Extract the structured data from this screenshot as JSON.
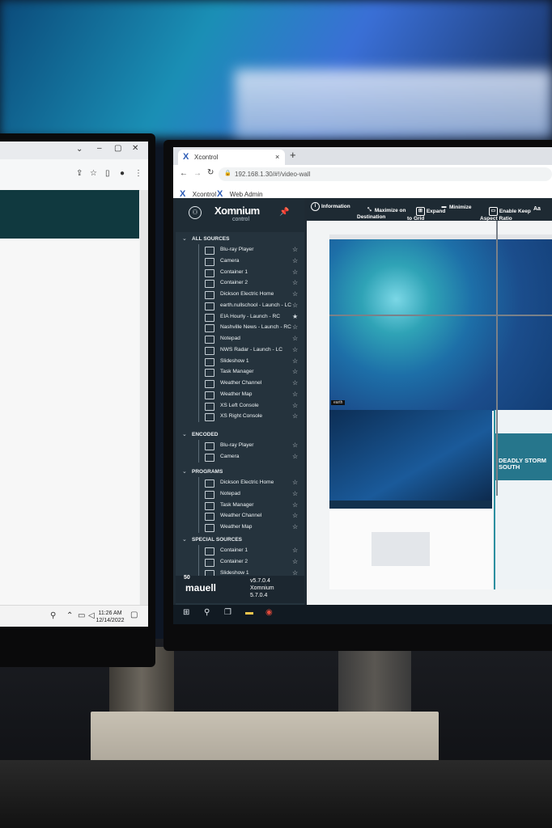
{
  "left_screen": {
    "clock_time": "11:26 AM",
    "clock_date": "12/14/2022"
  },
  "browser": {
    "tab_title": "Xcontrol",
    "new_tab": "+",
    "tab_close": "×",
    "url": "192.168.1.30/#!/video-wall",
    "bookmarks": [
      {
        "label": "Xcontrol"
      },
      {
        "label": "Web Admin"
      }
    ]
  },
  "app": {
    "brand_name": "Xomnium",
    "brand_sub": "control",
    "toolbar": {
      "information": "Information",
      "maximize": "Maximize on\nDestination",
      "expand": "Expand\nto Grid",
      "minimize": "Minimize",
      "keep_aspect": "Enable Keep\nAspect Ratio"
    },
    "sections": {
      "all_sources": "ALL SOURCES",
      "encoded": "ENCODED",
      "programs": "PROGRAMS",
      "special": "SPECIAL SOURCES"
    },
    "all_sources_items": [
      {
        "label": "Blu-ray Player",
        "star": "☆",
        "icon": "projector-icon"
      },
      {
        "label": "Camera",
        "star": "☆",
        "icon": "camera-icon"
      },
      {
        "label": "Container 1",
        "star": "☆",
        "icon": "grid-icon"
      },
      {
        "label": "Container 2",
        "star": "☆",
        "icon": "grid-icon"
      },
      {
        "label": "Dickson Electric Home",
        "star": "☆",
        "icon": "window-icon"
      },
      {
        "label": "earth.nullschool - Launch - LC",
        "star": "☆",
        "icon": "cast-icon"
      },
      {
        "label": "EIA Hourly - Launch - RC",
        "star": "★",
        "icon": "cast-icon"
      },
      {
        "label": "Nashville News - Launch - RC",
        "star": "☆",
        "icon": "cast-icon"
      },
      {
        "label": "Notepad",
        "star": "☆",
        "icon": "window-icon"
      },
      {
        "label": "NWS Radar - Launch - LC",
        "star": "☆",
        "icon": "cast-icon"
      },
      {
        "label": "Slideshow 1",
        "star": "☆",
        "icon": "slideshow-icon"
      },
      {
        "label": "Task Manager",
        "star": "☆",
        "icon": "window-icon"
      },
      {
        "label": "Weather Channel",
        "star": "☆",
        "icon": "window-icon"
      },
      {
        "label": "Weather Map",
        "star": "☆",
        "icon": "window-icon"
      },
      {
        "label": "XS Left Console",
        "star": "☆",
        "icon": "monitor-icon"
      },
      {
        "label": "XS Right Console",
        "star": "☆",
        "icon": "monitor-icon"
      }
    ],
    "encoded_items": [
      {
        "label": "Blu-ray Player",
        "star": "☆"
      },
      {
        "label": "Camera",
        "star": "☆"
      }
    ],
    "programs_items": [
      {
        "label": "Dickson Electric Home",
        "star": "☆"
      },
      {
        "label": "Notepad",
        "star": "☆"
      },
      {
        "label": "Task Manager",
        "star": "☆"
      },
      {
        "label": "Weather Channel",
        "star": "☆"
      },
      {
        "label": "Weather Map",
        "star": "☆"
      }
    ],
    "special_items": [
      {
        "label": "Container 1",
        "star": "☆"
      },
      {
        "label": "Container 2",
        "star": "☆"
      },
      {
        "label": "Slideshow 1",
        "star": "☆"
      }
    ],
    "footer": {
      "logo_top": "50",
      "logo": "mauell",
      "version_line1": "v5.7.0.4",
      "version_line2": "Xomnium",
      "version_line3": "5.7.0.4"
    },
    "wall": {
      "tile_tag": "earth",
      "news_headline": "DEADLY STORM\nSOUTH"
    }
  },
  "colors": {
    "sidebar_bg": "#25333d",
    "toolbar_bg": "#1e2a33",
    "accent": "#2b5bb5"
  }
}
